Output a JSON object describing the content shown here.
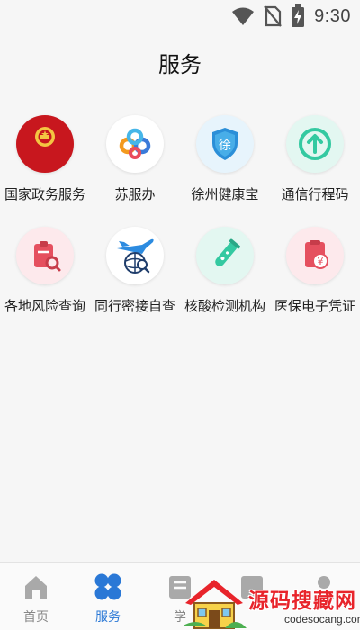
{
  "status_bar": {
    "time": "9:30",
    "icons": [
      "wifi-icon",
      "no-sim-icon",
      "battery-charging-icon"
    ]
  },
  "header": {
    "title": "服务"
  },
  "services": [
    [
      {
        "label": "国家政务服务",
        "icon": "national-emblem-icon",
        "bg": "#c8171e",
        "emblem_text": "国家政务服务"
      },
      {
        "label": "苏服办",
        "icon": "su-logo-icon",
        "bg": "#ffffff"
      },
      {
        "label": "徐州健康宝",
        "icon": "shield-icon",
        "bg": "#e7f4fc",
        "badge_text": "徐"
      },
      {
        "label": "通信行程码",
        "icon": "arrow-up-circle-icon",
        "bg": "#e3f7f1"
      }
    ],
    [
      {
        "label": "各地风险查询",
        "icon": "clipboard-search-icon",
        "bg": "#fde9ec"
      },
      {
        "label": "同行密接自查",
        "icon": "plane-globe-search-icon",
        "bg": "#ffffff"
      },
      {
        "label": "核酸检测机构",
        "icon": "test-tube-icon",
        "bg": "#e3f7f1"
      },
      {
        "label": "医保电子凭证",
        "icon": "insurance-card-icon",
        "bg": "#fde9ec",
        "badge_text": "¥"
      }
    ]
  ],
  "bottom_nav": [
    {
      "label": "首页",
      "icon": "home-icon",
      "active": false
    },
    {
      "label": "服务",
      "icon": "services-grid-icon",
      "active": true
    },
    {
      "label": "学",
      "icon": "study-icon",
      "active": false
    },
    {
      "label": "",
      "icon": "card-icon",
      "active": false
    },
    {
      "label": "",
      "icon": "profile-icon",
      "active": false
    }
  ],
  "watermark": {
    "title": "源码搜藏网",
    "url": "codesocang.com"
  },
  "colors": {
    "accent": "#2a78d6",
    "emblem_red": "#c8171e",
    "risk_red": "#e5505f",
    "teal": "#34c9a1"
  }
}
